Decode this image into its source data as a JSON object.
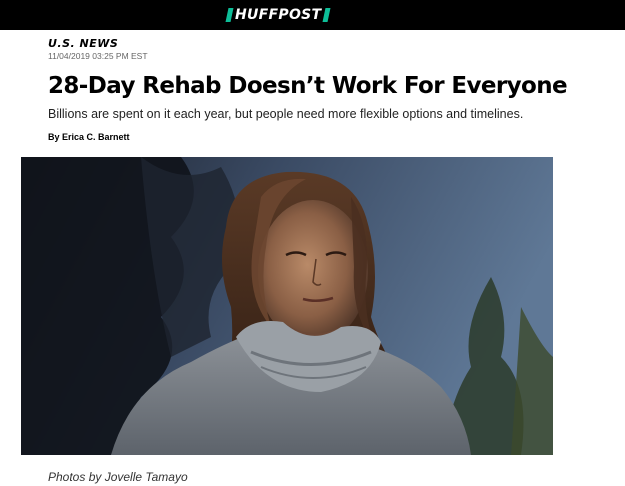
{
  "header": {
    "logo_text": "HUFFPOST",
    "brand_color": "#0dbe98"
  },
  "article": {
    "section": "U.S. NEWS",
    "timestamp": "11/04/2019 03:25 PM EST",
    "headline": "28-Day Rehab Doesn’t Work For Everyone",
    "subheadline": "Billions are spent on it each year, but people need more flexible options and timelines.",
    "byline": "By Erica C. Barnett",
    "photo_credit": "Photos by Jovelle Tamayo"
  }
}
